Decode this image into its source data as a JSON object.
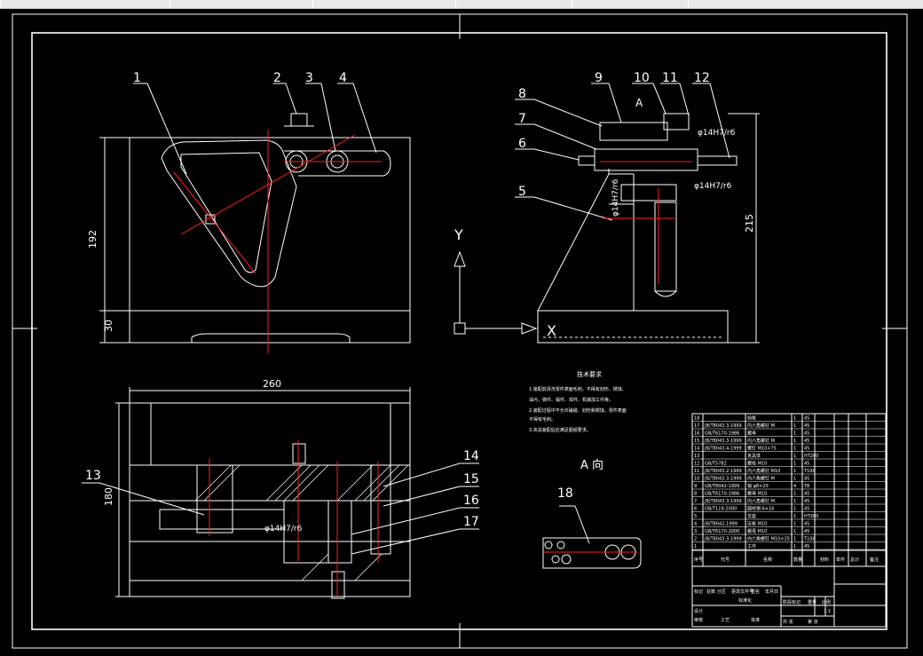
{
  "window": {
    "tabs": [
      "",
      "",
      "",
      "",
      "",
      ""
    ]
  },
  "drawing": {
    "colors": {
      "background": "#000000",
      "line": "#ffffff",
      "center": "#ff2020",
      "dim": "#ffffff"
    },
    "part_numbers": [
      "1",
      "2",
      "3",
      "4",
      "5",
      "6",
      "7",
      "8",
      "9",
      "10",
      "11",
      "12",
      "13",
      "14",
      "15",
      "16",
      "17",
      "18"
    ],
    "dimensions": {
      "height_front": "192",
      "base_front": "30",
      "side_height": "215",
      "top_width": "260",
      "top_height": "180",
      "fit_1": "φ14H7/r6",
      "fit_2": "φ14H7/r6",
      "fit_3": "φ14H7/r6",
      "fit_4": "φ14H7/r6"
    },
    "axis_labels": {
      "y": "Y",
      "x": "X"
    },
    "section_a": "A",
    "view_a_label": "A 向",
    "notes_title": "技术要求",
    "notes": [
      "1.装配前清洗零件表面毛刺，不得有划伤、锈蚀、",
      "油污，铸件、锻件、焊件、机械加工件等。",
      "2.装配过程中不允许磕碰、划伤和锈蚀，零件表面",
      "不得有毛刺。",
      "3.夹具装配后应满足图纸要求。"
    ],
    "bom": [
      {
        "no": "18",
        "std": "",
        "name": "挡板",
        "qty": "1",
        "mat": "45"
      },
      {
        "no": "17",
        "std": "JB/T8043.3-1999",
        "name": "内六角螺钉 M",
        "qty": "1",
        "mat": "45"
      },
      {
        "no": "16",
        "std": "GB/T6170-1986",
        "name": "螺母",
        "qty": "1",
        "mat": "45"
      },
      {
        "no": "15",
        "std": "JB/T8043.3-1999",
        "name": "内六角螺钉 M",
        "qty": "1",
        "mat": "45"
      },
      {
        "no": "14",
        "std": "JB/T8043.4-1999",
        "name": "螺钉 M10×75",
        "qty": "1",
        "mat": "45"
      },
      {
        "no": "13",
        "std": "",
        "name": "夹具体",
        "qty": "1",
        "mat": "HT200"
      },
      {
        "no": "12",
        "std": "GB/T5782",
        "name": "螺栓 M10",
        "qty": "1",
        "mat": "45"
      },
      {
        "no": "11",
        "std": "JB/T8043.2-1999",
        "name": "内六角螺钉 M10",
        "qty": "1",
        "mat": "T10A"
      },
      {
        "no": "10",
        "std": "JB/T8043.3-1999",
        "name": "内六角螺钉 M",
        "qty": "1",
        "mat": "45"
      },
      {
        "no": "9",
        "std": "GB/T8042-1999",
        "name": "销 φ8×20",
        "qty": "4",
        "mat": "T8"
      },
      {
        "no": "8",
        "std": "GB/T6170-1986",
        "name": "螺母 M10",
        "qty": "1",
        "mat": "45"
      },
      {
        "no": "7",
        "std": "JB/T8043.3-1999",
        "name": "内六角螺钉 M",
        "qty": "1",
        "mat": "45"
      },
      {
        "no": "6",
        "std": "GB/T119-2000",
        "name": "圆柱销 6×16",
        "qty": "1",
        "mat": "45"
      },
      {
        "no": "5",
        "std": "",
        "name": "支座",
        "qty": "1",
        "mat": "HT200"
      },
      {
        "no": "4",
        "std": "JB/T8042-1999",
        "name": "压板 M10",
        "qty": "1",
        "mat": "45"
      },
      {
        "no": "3",
        "std": "GB/T6170-2000",
        "name": "螺母 M10",
        "qty": "1",
        "mat": "45"
      },
      {
        "no": "2",
        "std": "JB/T8043.3-1999",
        "name": "内六角螺钉 M10×25",
        "qty": "1",
        "mat": "T10A"
      },
      {
        "no": "1",
        "std": "",
        "name": "工件",
        "qty": "1",
        "mat": "45"
      }
    ],
    "bom_header": [
      "序号",
      "代号",
      "名称",
      "数量",
      "材料",
      "单件",
      "总计",
      "备注"
    ],
    "title_block": {
      "r1": [
        "标记",
        "处数",
        "分区",
        "更改文件号",
        "签名",
        "年月日"
      ],
      "r2": [
        "设计",
        "",
        "",
        "标准化",
        "",
        ""
      ],
      "stage": "阶段标记",
      "weight": "重量",
      "scale": "比例",
      "scale_val": "1:1",
      "sheet": "共 张",
      "sheet2": "第 张",
      "check": "审核",
      "process": "工艺",
      "approve": "批准"
    }
  }
}
